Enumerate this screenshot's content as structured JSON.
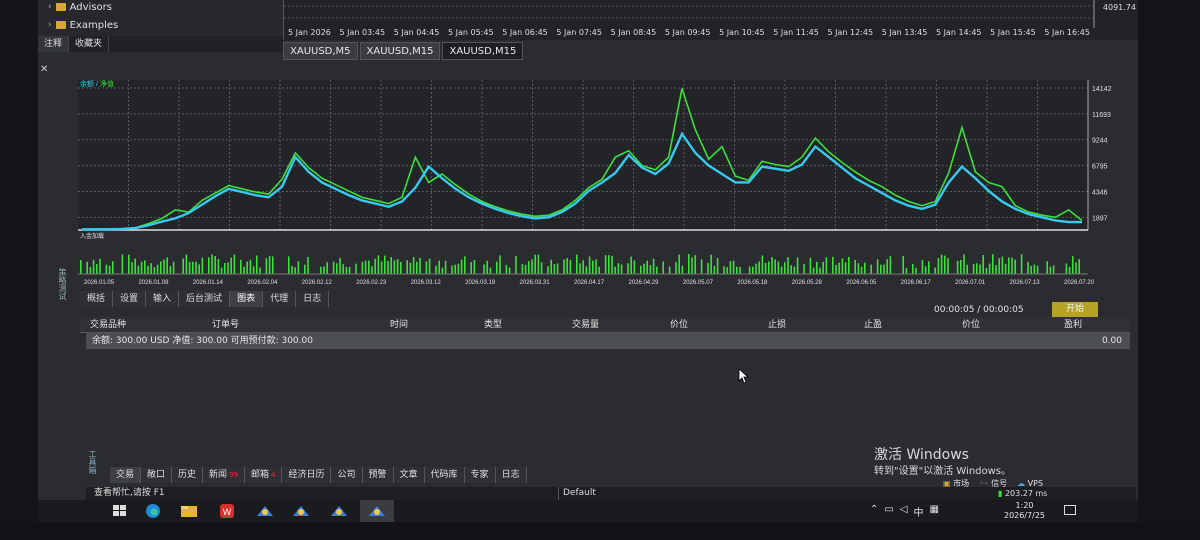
{
  "navigator": {
    "items": [
      "Advisors",
      "Examples"
    ],
    "tabs": [
      "注释",
      "收藏夹"
    ]
  },
  "top_chart": {
    "price": "4091.74",
    "axis_labels": [
      "5 Jan 2026",
      "5 Jan 03:45",
      "5 Jan 04:45",
      "5 Jan 05:45",
      "5 Jan 06:45",
      "5 Jan 07:45",
      "5 Jan 08:45",
      "5 Jan 09:45",
      "5 Jan 10:45",
      "5 Jan 11:45",
      "5 Jan 12:45",
      "5 Jan 13:45",
      "5 Jan 14:45",
      "5 Jan 15:45",
      "5 Jan 16:45"
    ]
  },
  "chart_tabs": [
    "XAUUSD,M5",
    "XAUUSD,M15",
    "XAUUSD,M15"
  ],
  "tester": {
    "legend": "余额 / 净值",
    "deposit_label": "入金加载",
    "tabs": [
      "概括",
      "设置",
      "输入",
      "后台测试",
      "图表",
      "代理",
      "日志"
    ],
    "active_tab": "图表",
    "timer": "00:00:05 / 00:00:05",
    "start_button": "开始",
    "sidelabel": "策略测试"
  },
  "chart_data": {
    "type": "line",
    "title": "",
    "series": [
      {
        "name": "余额",
        "color": "#39c8f0"
      },
      {
        "name": "净值",
        "color": "#3be03b"
      }
    ],
    "x_labels": [
      "2026.01.05",
      "2026.01.08",
      "2026.01.14",
      "2026.02.04",
      "2026.02.12",
      "2026.02.23",
      "2026.03.12",
      "2026.03.19",
      "2026.03.31",
      "2026.04.17",
      "2026.04.29",
      "2026.05.07",
      "2026.05.18",
      "2026.05.28",
      "2026.06.05",
      "2026.06.17",
      "2026.07.01",
      "2026.07.13",
      "2026.07.20"
    ],
    "y_ticks": [
      1897,
      4346,
      6795,
      9244,
      11693,
      14142
    ],
    "ylim": [
      700,
      14900
    ],
    "balance": [
      760,
      760,
      780,
      800,
      880,
      1150,
      1500,
      1800,
      2300,
      3100,
      3900,
      4600,
      4300,
      4000,
      3800,
      4800,
      7600,
      6200,
      5200,
      4600,
      4000,
      3500,
      3200,
      2900,
      3400,
      4700,
      6700,
      5600,
      4600,
      3800,
      3200,
      2700,
      2300,
      2000,
      1800,
      1900,
      2400,
      3200,
      4400,
      5200,
      6100,
      7800,
      6600,
      6000,
      7000,
      9800,
      8000,
      6800,
      6000,
      5200,
      5200,
      6700,
      6500,
      6300,
      6900,
      8600,
      7600,
      6600,
      5600,
      4900,
      4200,
      3500,
      3000,
      2700,
      3100,
      5200,
      6700,
      5600,
      4400,
      3400,
      2700,
      2200,
      1900,
      1600,
      1450,
      1450
    ],
    "equity": [
      780,
      780,
      800,
      820,
      900,
      1300,
      1800,
      2600,
      2400,
      3500,
      4200,
      4900,
      4600,
      4300,
      4100,
      5500,
      8000,
      6600,
      5600,
      5000,
      4400,
      3800,
      3500,
      3200,
      3800,
      7600,
      5200,
      6000,
      5000,
      4100,
      3400,
      2900,
      2500,
      2200,
      2000,
      2100,
      2600,
      3500,
      4700,
      5500,
      7600,
      8200,
      6800,
      6400,
      7600,
      14100,
      10200,
      7400,
      8600,
      5800,
      5400,
      7200,
      6900,
      6700,
      7600,
      9400,
      8100,
      7100,
      6200,
      5400,
      4800,
      4000,
      3400,
      3000,
      3400,
      6100,
      10400,
      6200,
      5200,
      4800,
      3000,
      2400,
      2100,
      1900,
      2600,
      1600
    ]
  },
  "trade_table": {
    "columns": [
      "交易品种",
      "订单号",
      "时间",
      "类型",
      "交易量",
      "价位",
      "止损",
      "止盈",
      "价位",
      "盈利"
    ],
    "balance_row": "余额: 300.00 USD  净值: 300.00  可用预付款: 300.00",
    "balance_value": "0.00"
  },
  "activation": {
    "title": "激活 Windows",
    "subtitle": "转到\"设置\"以激活 Windows。"
  },
  "toolbox": {
    "label": "工具箱",
    "tabs": [
      "交易",
      "敞口",
      "历史",
      "新闻",
      "邮箱",
      "经济日历",
      "公司",
      "预警",
      "文章",
      "代码库",
      "专家",
      "日志"
    ],
    "active_tab": "交易",
    "news_badge": "99",
    "mail_badge": "4"
  },
  "market": {
    "market": "市场",
    "signals": "信号",
    "vps": "VPS"
  },
  "status": {
    "help": "查看帮忙,请按 F1",
    "profile": "Default",
    "ping": "203.27 ms"
  },
  "taskbar": {
    "time": "1:20",
    "date": "2026/7/25",
    "ime": "中"
  }
}
